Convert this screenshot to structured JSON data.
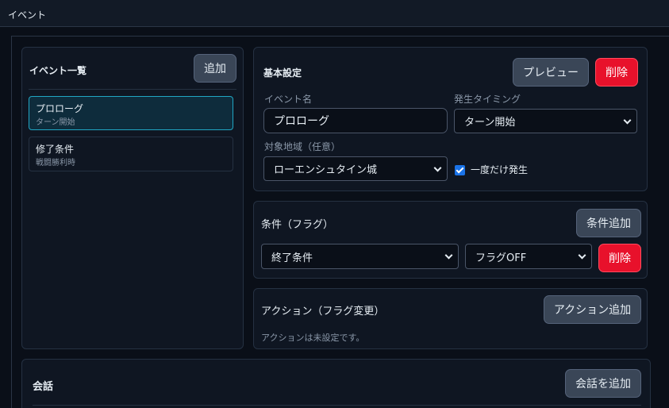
{
  "window": {
    "title": "イベント"
  },
  "event_list": {
    "heading": "イベント一覧",
    "add_label": "追加",
    "items": [
      {
        "title": "プロローグ",
        "subtitle": "ターン開始",
        "selected": true
      },
      {
        "title": "修了条件",
        "subtitle": "戦闘勝利時",
        "selected": false
      }
    ]
  },
  "basic": {
    "heading": "基本設定",
    "preview_label": "プレビュー",
    "delete_label": "削除",
    "name_label": "イベント名",
    "name_value": "プロローグ",
    "timing_label": "発生タイミング",
    "timing_value": "ターン開始",
    "region_label": "対象地域（任意）",
    "region_value": "ローエンシュタイン城",
    "once_label": "一度だけ発生",
    "once_checked": true
  },
  "conditions": {
    "heading": "条件（フラグ）",
    "add_label": "条件追加",
    "flag_value": "終了条件",
    "state_value": "フラグOFF",
    "delete_label": "削除"
  },
  "actions": {
    "heading": "アクション（フラグ変更）",
    "add_label": "アクション追加",
    "empty_text": "アクションは未設定です。"
  },
  "dialogue": {
    "heading": "会話",
    "add_label": "会話を追加"
  },
  "colors": {
    "accent": "#21a6c3",
    "danger": "#e8112b",
    "background": "#0a0f18",
    "checkbox": "#1a73e8"
  }
}
